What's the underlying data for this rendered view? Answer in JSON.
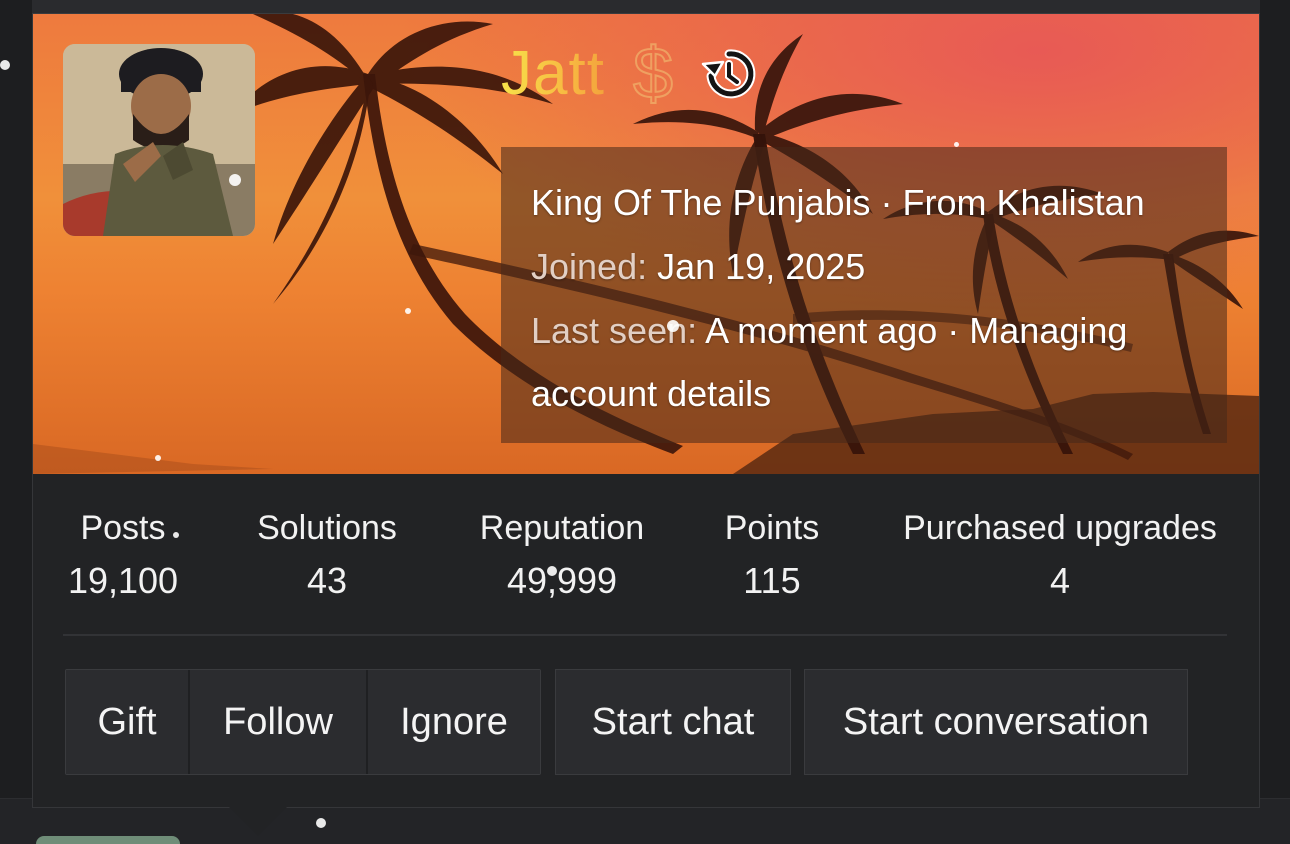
{
  "profile": {
    "username": "Jatt",
    "dollar_icon": "dollar-sign-icon",
    "history_icon": "history-icon",
    "title_line_left": "King Of The Punjabis",
    "separator": " · ",
    "title_line_right": "From Khalistan",
    "joined_label": "Joined:",
    "joined_value": "Jan 19, 2025",
    "last_seen_label": "Last seen:",
    "last_seen_value_1": "A moment ago",
    "last_seen_value_2": "Managing",
    "last_seen_value_3": "account details"
  },
  "stats": [
    {
      "label": "Posts",
      "value": "19,100"
    },
    {
      "label": "Solutions",
      "value": "43"
    },
    {
      "label": "Reputation",
      "value": "49,999"
    },
    {
      "label": "Points",
      "value": "115"
    },
    {
      "label": "Purchased upgrades",
      "value": "4"
    }
  ],
  "actions": {
    "gift": "Gift",
    "follow": "Follow",
    "ignore": "Ignore",
    "start_chat": "Start chat",
    "start_conversation": "Start conversation"
  },
  "colors": {
    "username_gradient_start": "#f7e24a",
    "username_gradient_end": "#f3a33c",
    "card_background": "#222325",
    "button_background": "#2b2c2f"
  }
}
